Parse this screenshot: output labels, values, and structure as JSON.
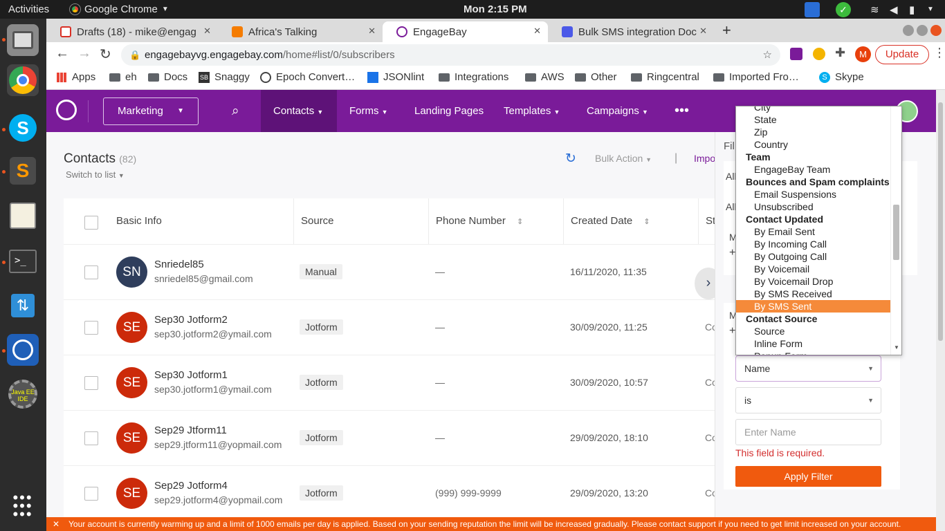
{
  "os": {
    "activities": "Activities",
    "app_name": "Google Chrome",
    "clock": "Mon  2:15 PM"
  },
  "browser": {
    "tabs": [
      {
        "label": "Drafts (18) - mike@engag"
      },
      {
        "label": "Africa's Talking"
      },
      {
        "label": "EngageBay"
      },
      {
        "label": "Bulk SMS integration Doc"
      }
    ],
    "url_domain": "engagebayvg.engagebay.com",
    "url_path": "/home#list/0/subscribers",
    "update_label": "Update",
    "profile_initial": "M",
    "bookmarks": [
      "Apps",
      "eh",
      "Docs",
      "Snaggy",
      "Epoch Convert…",
      "JSONlint",
      "Integrations",
      "AWS",
      "Other",
      "Ringcentral",
      "Imported Fro…",
      "Skype"
    ]
  },
  "app": {
    "module": "Marketing",
    "nav": [
      "Contacts",
      "Forms",
      "Landing Pages",
      "Templates",
      "Campaigns"
    ],
    "accent": "#7a1b99"
  },
  "contacts": {
    "title": "Contacts",
    "count": "(82)",
    "switch": "Switch to list",
    "bulk_action": "Bulk Action",
    "import": "Impo",
    "columns": [
      "Basic Info",
      "Source",
      "Phone Number",
      "Created Date",
      "St"
    ],
    "rows": [
      {
        "initials": "SN",
        "name": "Snriedel85",
        "email": "snriedel85@gmail.com",
        "source": "Manual",
        "phone": "—",
        "created": "16/11/2020, 11:35",
        "status": ""
      },
      {
        "initials": "SE",
        "name": "Sep30 Jotform2",
        "email": "sep30.jotform2@ymail.com",
        "source": "Jotform",
        "phone": "—",
        "created": "30/09/2020, 11:25",
        "status": "Co"
      },
      {
        "initials": "SE",
        "name": "Sep30 Jotform1",
        "email": "sep30.jotform1@ymail.com",
        "source": "Jotform",
        "phone": "—",
        "created": "30/09/2020, 10:57",
        "status": "Co"
      },
      {
        "initials": "SE",
        "name": "Sep29 Jtform11",
        "email": "sep29.jtform11@yopmail.com",
        "source": "Jotform",
        "phone": "—",
        "created": "29/09/2020, 18:10",
        "status": "Co"
      },
      {
        "initials": "SE",
        "name": "Sep29 Jotform4",
        "email": "sep29.jotform4@yopmail.com",
        "source": "Jotform",
        "phone": "(999) 999-9999",
        "created": "29/09/2020, 13:20",
        "status": "Co"
      }
    ]
  },
  "filter": {
    "title": "Fil",
    "all1": "All",
    "all2": "All",
    "m1": "M",
    "m2": "M",
    "field_value": "Name",
    "op_value": "is",
    "input_placeholder": "Enter Name",
    "error": "This field is required.",
    "apply": "Apply Filter"
  },
  "dropdown_items": [
    {
      "label": "City",
      "group": false
    },
    {
      "label": "State",
      "group": false
    },
    {
      "label": "Zip",
      "group": false
    },
    {
      "label": "Country",
      "group": false
    },
    {
      "label": "Team",
      "group": true
    },
    {
      "label": "EngageBay Team",
      "group": false
    },
    {
      "label": "Bounces and Spam complaints",
      "group": true
    },
    {
      "label": "Email Suspensions",
      "group": false
    },
    {
      "label": "Unsubscribed",
      "group": false
    },
    {
      "label": "Contact Updated",
      "group": true
    },
    {
      "label": "By Email Sent",
      "group": false
    },
    {
      "label": "By Incoming Call",
      "group": false
    },
    {
      "label": "By Outgoing Call",
      "group": false
    },
    {
      "label": "By Voicemail",
      "group": false
    },
    {
      "label": "By Voicemail Drop",
      "group": false
    },
    {
      "label": "By SMS Received",
      "group": false
    },
    {
      "label": "By SMS Sent",
      "group": false,
      "selected": true
    },
    {
      "label": "Contact Source",
      "group": true
    },
    {
      "label": "Source",
      "group": false
    },
    {
      "label": "Inline Form",
      "group": false
    },
    {
      "label": "Popup Form",
      "group": false
    }
  ],
  "banner": "Your account is currently warming up and a limit of 1000 emails per day is applied. Based on your sending reputation the limit will be increased gradually. Please contact support if you need to get limit increased on your account.",
  "dock_apps": [
    "file-manager-icon",
    "chrome-icon",
    "skype-icon",
    "sublime-icon",
    "text-editor-icon",
    "terminal-icon",
    "update-icon",
    "hex-app-icon",
    "java-ide-icon",
    "app-grid-icon"
  ]
}
